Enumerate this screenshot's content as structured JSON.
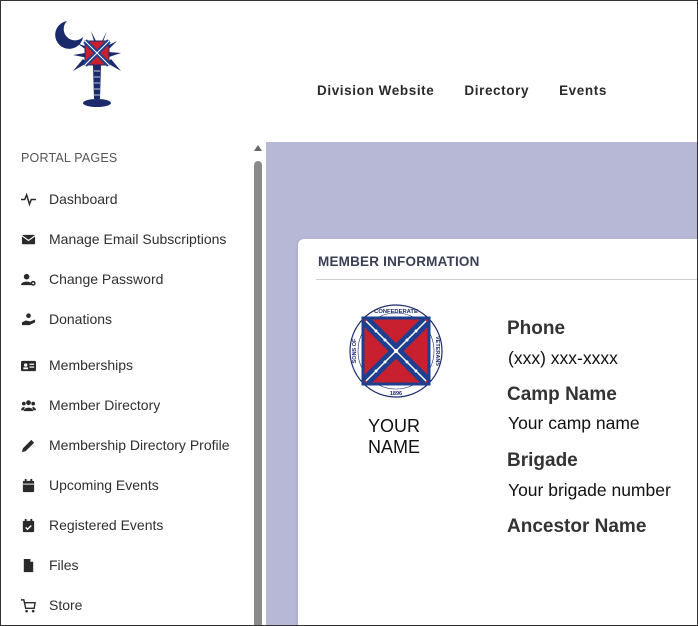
{
  "header": {
    "nav": [
      "Division Website",
      "Directory",
      "Events"
    ]
  },
  "sidebar": {
    "heading": "PORTAL PAGES",
    "items": [
      {
        "label": "Dashboard",
        "icon": "pulse-icon"
      },
      {
        "label": "Manage Email Subscriptions",
        "icon": "envelope-icon"
      },
      {
        "label": "Change Password",
        "icon": "user-gear-icon"
      },
      {
        "label": "Donations",
        "icon": "hand-holding-icon"
      },
      {
        "label": "Memberships",
        "icon": "id-card-icon"
      },
      {
        "label": "Member Directory",
        "icon": "users-icon"
      },
      {
        "label": "Membership Directory Profile",
        "icon": "pencil-icon"
      },
      {
        "label": "Upcoming Events",
        "icon": "calendar-icon"
      },
      {
        "label": "Registered Events",
        "icon": "calendar-check-icon"
      },
      {
        "label": "Files",
        "icon": "file-icon"
      },
      {
        "label": "Store",
        "icon": "cart-icon"
      }
    ]
  },
  "card": {
    "title": "MEMBER INFORMATION",
    "emblem_text": {
      "top": "CONFEDERATE",
      "left": "SONS OF",
      "right": "VETERANS",
      "bottom": "1896"
    },
    "name_line1": "YOUR",
    "name_line2": "NAME",
    "fields": [
      {
        "label": "Phone",
        "value": "(xxx) xxx-xxxx"
      },
      {
        "label": "Camp Name",
        "value": "Your camp name"
      },
      {
        "label": "Brigade",
        "value": "Your brigade number"
      },
      {
        "label": "Ancestor Name",
        "value": ""
      }
    ]
  },
  "colors": {
    "main_background": "#b6b8d6",
    "flag_red": "#c8202e",
    "flag_blue": "#1e3f8f",
    "logo_navy": "#1b2a6b"
  }
}
